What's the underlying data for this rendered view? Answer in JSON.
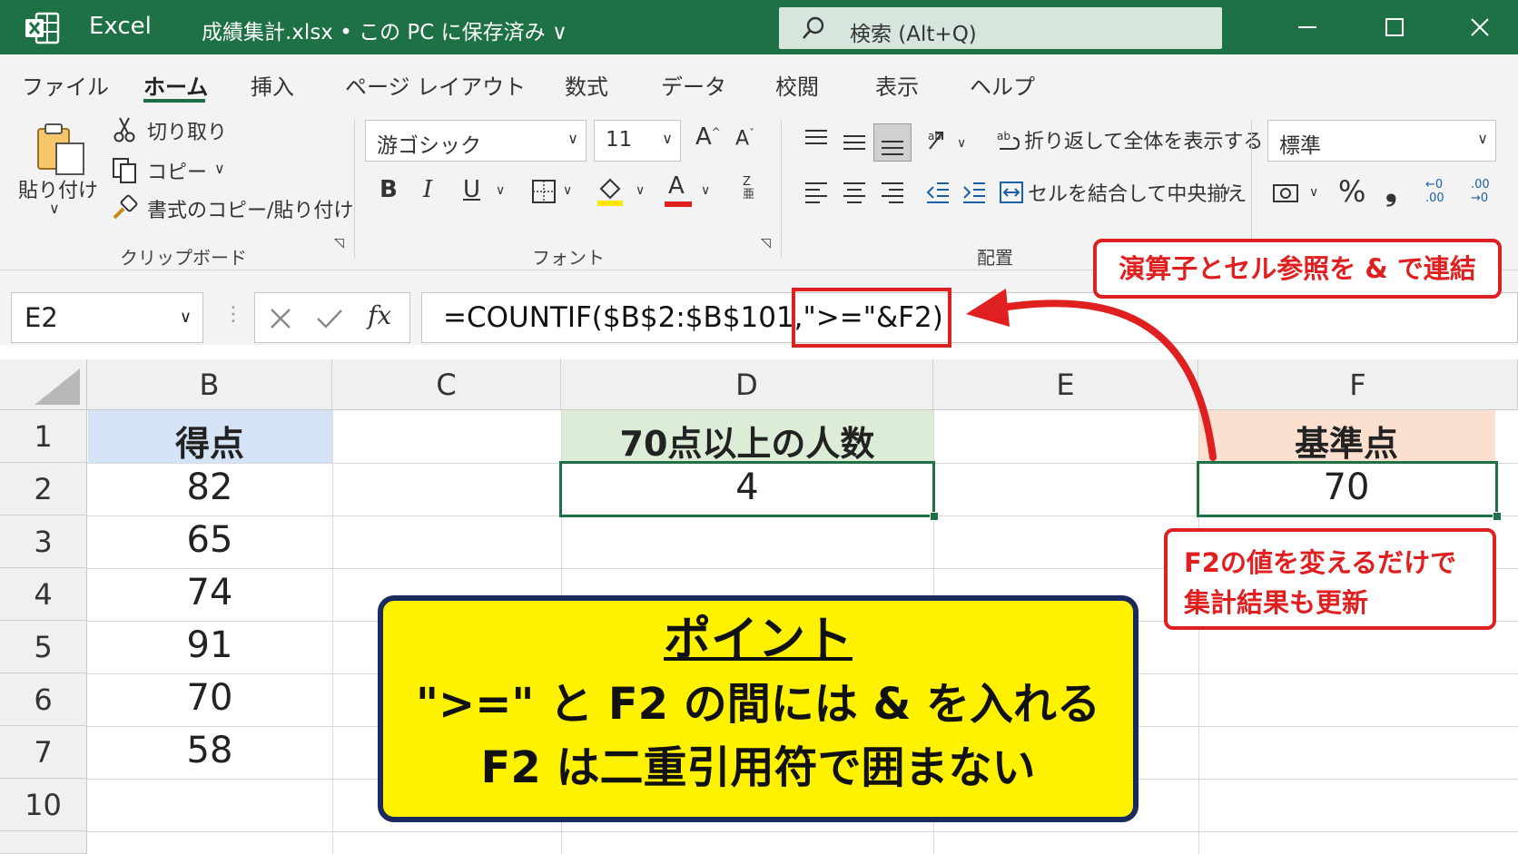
{
  "titlebar": {
    "app_name": "Excel",
    "file_title": "成績集計.xlsx • この PC に保存済み ∨",
    "search_placeholder": "検索 (Alt+Q)"
  },
  "tabs": [
    "ファイル",
    "ホーム",
    "挿入",
    "ページ レイアウト",
    "数式",
    "データ",
    "校閲",
    "表示",
    "ヘルプ"
  ],
  "ribbon": {
    "clipboard": {
      "paste": "貼り付け",
      "cut": "切り取り",
      "copy": "コピー",
      "format_painter": "書式のコピー/貼り付け",
      "label": "クリップボード"
    },
    "font": {
      "name": "游ゴシック",
      "size": "11",
      "label": "フォント"
    },
    "alignment": {
      "wrap": "折り返して全体を表示する",
      "merge": "セルを結合して中央揃え",
      "label": "配置"
    },
    "number": {
      "format": "標準"
    }
  },
  "formula_bar": {
    "name_box": "E2",
    "formula": "=COUNTIF($B$2:$B$101,\">=\"&F2)"
  },
  "columns": [
    "B",
    "C",
    "D",
    "E",
    "F"
  ],
  "rows": [
    "1",
    "2",
    "3",
    "4",
    "5",
    "6",
    "7",
    "10"
  ],
  "cells": {
    "B1": "得点",
    "B2": "82",
    "B3": "65",
    "B4": "74",
    "B5": "91",
    "B6": "70",
    "B7": "58",
    "D1": "70点以上の人数",
    "D2": "4",
    "F1": "基準点",
    "F2": "70"
  },
  "callouts": {
    "concat": "演算子とセル参照を & で連結",
    "update_line1": "F2の値を変えるだけで",
    "update_line2": "集計結果も更新",
    "point_title": "ポイント",
    "point_line1": "\">=\" と F2 の間には & を入れる",
    "point_line2": "F2 は二重引用符で囲まない"
  },
  "colors": {
    "excel_green": "#1e7145",
    "header_blue": "#d4e3f5",
    "header_green": "#dcecd6",
    "header_orange": "#fbe0d0",
    "callout_red": "#e02020",
    "point_yellow": "#fff200"
  }
}
